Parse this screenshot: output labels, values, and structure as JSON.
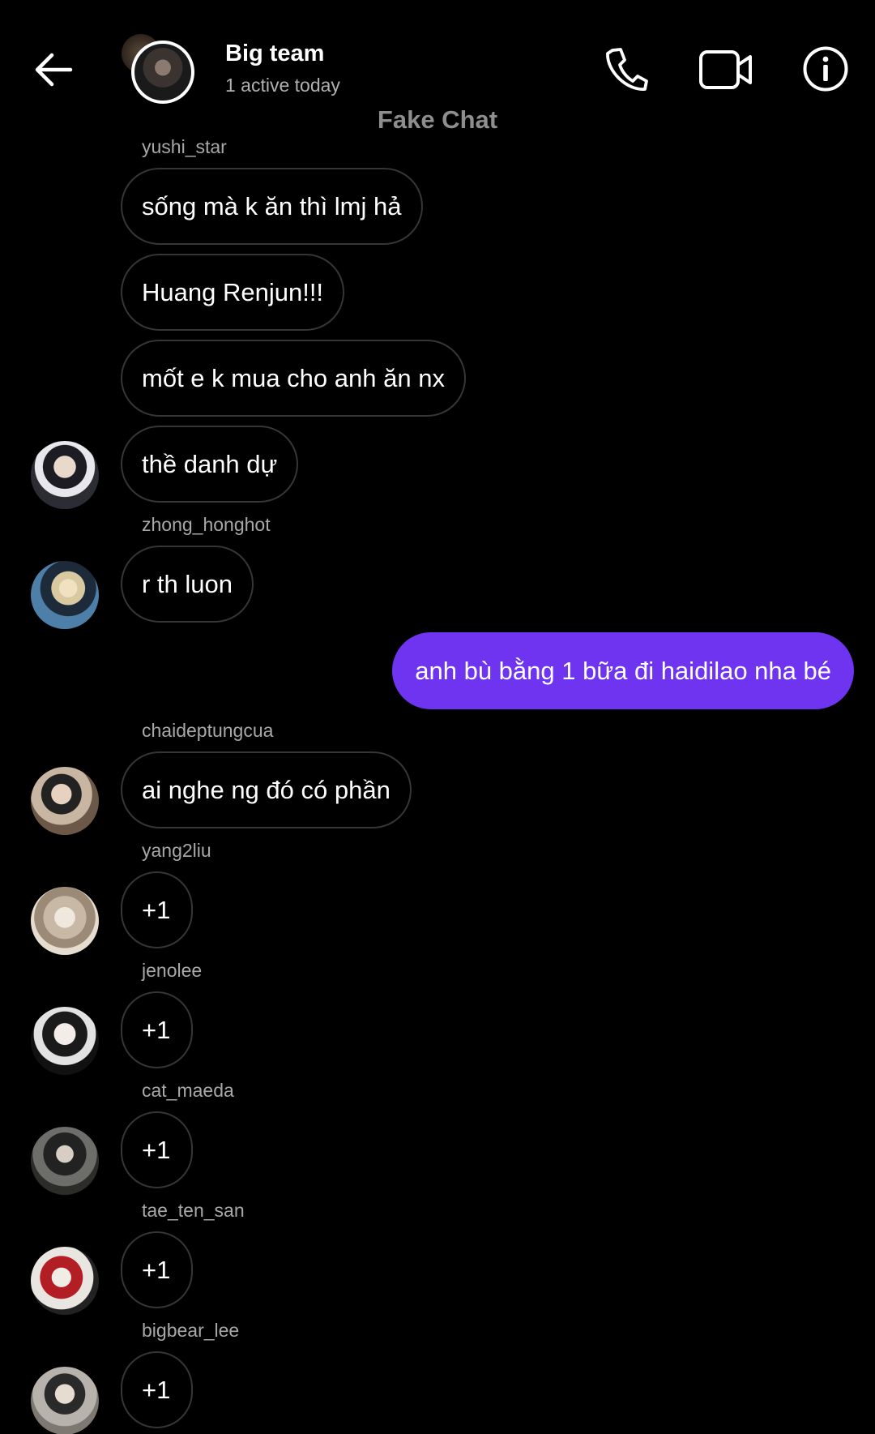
{
  "header": {
    "title": "Big team",
    "status": "1 active today",
    "icons": {
      "back": "arrow-left-icon",
      "call": "phone-icon",
      "video": "video-camera-icon",
      "info": "info-icon"
    }
  },
  "watermark": "Fake Chat",
  "messages": {
    "yushi_sender": "yushi_star",
    "m1": "sống mà k ăn thì lmj hả",
    "m2": "Huang Renjun!!!",
    "m3": "mốt e k mua cho anh ăn nx",
    "m4": "thề danh dự",
    "zhong_sender": "zhong_honghot",
    "m5": "r th luon",
    "mine1": "anh bù bằng 1 bữa đi haidilao nha bé",
    "chai_sender": "chaideptungcua",
    "m6": "ai nghe ng đó có phần",
    "yang_sender": "yang2liu",
    "m7": "+1",
    "jeno_sender": "jenolee",
    "m8": "+1",
    "cat_sender": "cat_maeda",
    "m9": "+1",
    "tae_sender": "tae_ten_san",
    "m10": "+1",
    "bigbear_sender": "bigbear_lee",
    "m11": "+1"
  },
  "colors": {
    "background": "#000000",
    "my_bubble": "#6e34f0",
    "bubble_border": "#363636",
    "secondary_text": "#a8a8a8"
  }
}
